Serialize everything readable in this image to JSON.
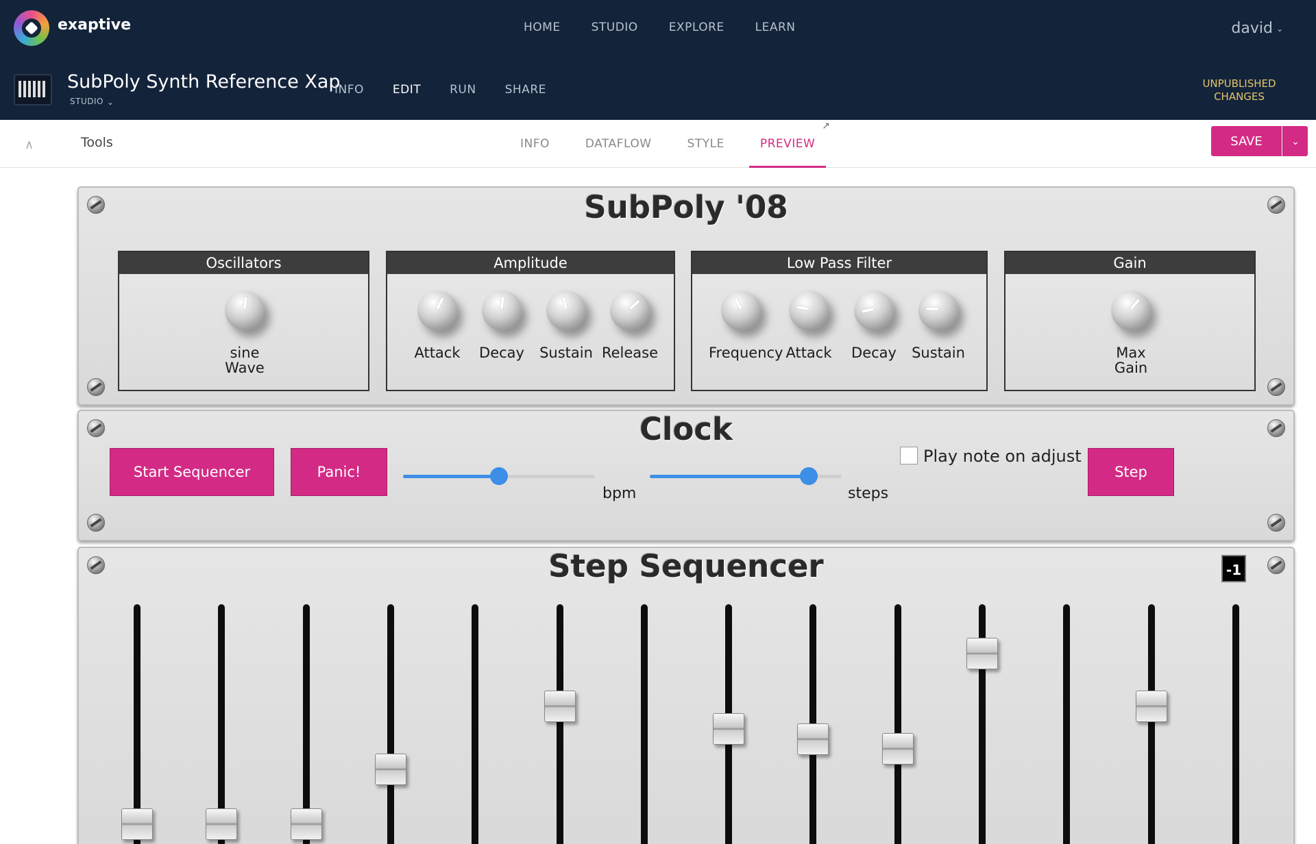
{
  "topbar": {
    "brand": "exaptive",
    "nav": [
      "HOME",
      "STUDIO",
      "EXPLORE",
      "LEARN"
    ],
    "user": "david"
  },
  "xap": {
    "title": "SubPoly Synth Reference Xap",
    "subtitle": "STUDIO",
    "nav": [
      "INFO",
      "EDIT",
      "RUN",
      "SHARE"
    ],
    "active_nav": "EDIT",
    "status_line1": "UNPUBLISHED",
    "status_line2": "CHANGES"
  },
  "toolbar": {
    "tools_label": "Tools",
    "tabs": [
      "INFO",
      "DATAFLOW",
      "STYLE",
      "PREVIEW"
    ],
    "active_tab": "PREVIEW",
    "save_label": "SAVE"
  },
  "synth": {
    "title": "SubPoly '08",
    "modules": [
      {
        "name": "Oscillators",
        "knobs": [
          {
            "label": "sine Wave",
            "value": 0.52
          }
        ]
      },
      {
        "name": "Amplitude",
        "knobs": [
          {
            "label": "Attack",
            "value": 0.6
          },
          {
            "label": "Decay",
            "value": 0.52
          },
          {
            "label": "Sustain",
            "value": 0.45
          },
          {
            "label": "Release",
            "value": 0.68
          }
        ]
      },
      {
        "name": "Low Pass Filter",
        "knobs": [
          {
            "label": "Frequency",
            "value": 0.4
          },
          {
            "label": "Attack",
            "value": 0.2
          },
          {
            "label": "Decay",
            "value": 0.12
          },
          {
            "label": "Sustain",
            "value": 0.17
          }
        ]
      },
      {
        "name": "Gain",
        "knobs": [
          {
            "label": "Max Gain",
            "value": 0.65
          }
        ]
      }
    ]
  },
  "clock": {
    "title": "Clock",
    "start_label": "Start Sequencer",
    "panic_label": "Panic!",
    "bpm_unit": "bpm",
    "bpm_value": 0.5,
    "steps_unit": "steps",
    "steps_value": 0.83,
    "checkbox_label": "Play note on adjust",
    "checkbox_checked": false,
    "step_label": "Step"
  },
  "sequencer": {
    "title": "Step Sequencer",
    "badge": "-1",
    "faders": [
      0.0,
      0.0,
      0.0,
      0.27,
      null,
      0.58,
      null,
      0.47,
      0.42,
      0.37,
      0.84,
      null,
      0.58,
      null
    ]
  },
  "colors": {
    "navy": "#13233a",
    "accent": "#d32b85",
    "slider": "#3d8ee6",
    "unpublished": "#e4c66a"
  }
}
